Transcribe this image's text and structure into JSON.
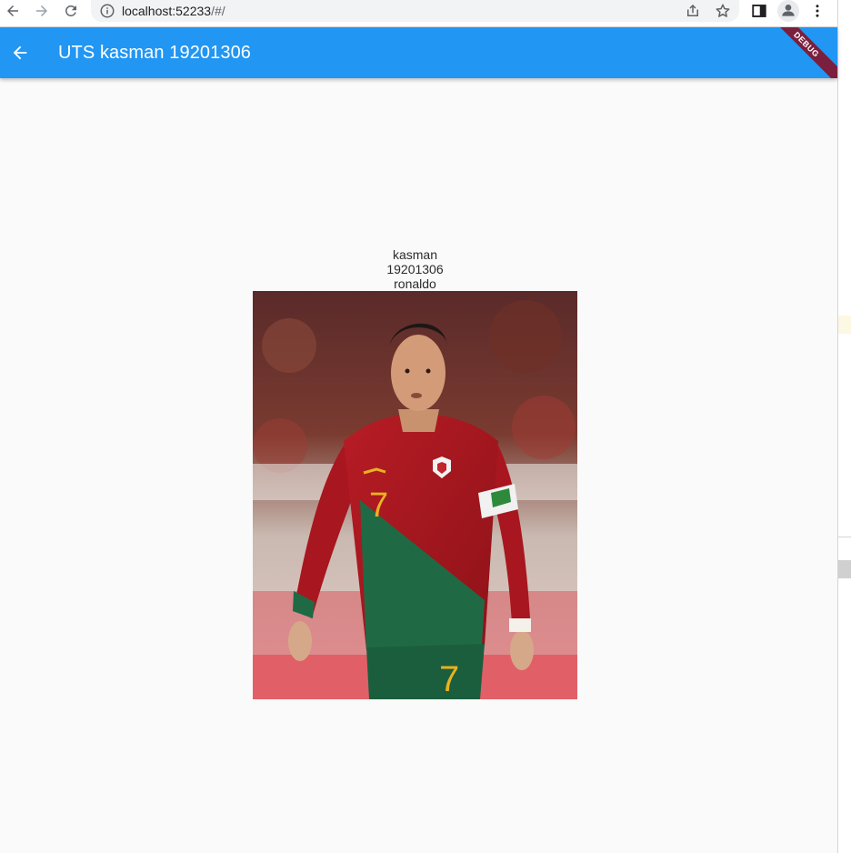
{
  "browser": {
    "url_host": "localhost:52233",
    "url_path": "/#/"
  },
  "app_bar": {
    "title": "UTS kasman 19201306",
    "debug_label": "DEBUG",
    "color": "#2196f3"
  },
  "content": {
    "line1": "kasman",
    "line2": "19201306",
    "line3": "ronaldo",
    "image_alt": "Photo of Cristiano Ronaldo in Portugal red and green jersey number 7"
  }
}
